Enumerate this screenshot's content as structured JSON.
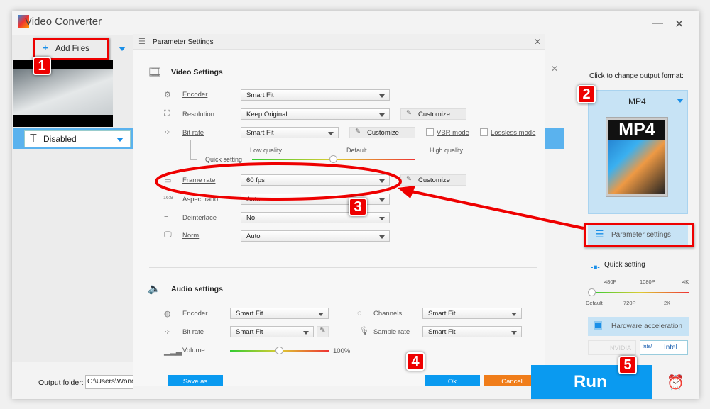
{
  "app": {
    "title": "Video Converter",
    "min": "—",
    "close": "✕"
  },
  "left": {
    "add_files": "Add Files",
    "subtitle": "Disabled"
  },
  "dialog": {
    "title": "Parameter Settings",
    "close": "✕",
    "video": {
      "heading": "Video Settings",
      "encoder": {
        "label": "Encoder",
        "value": "Smart Fit"
      },
      "resolution": {
        "label": "Resolution",
        "value": "Keep Original",
        "customize": "Customize"
      },
      "bitrate": {
        "label": "Bit rate",
        "value": "Smart Fit",
        "customize": "Customize",
        "vbr": "VBR mode",
        "lossless": "Lossless mode"
      },
      "quick": {
        "label": "Quick setting",
        "low": "Low quality",
        "default": "Default",
        "high": "High quality",
        "level": 0.5
      },
      "framerate": {
        "label": "Frame rate",
        "value": "60 fps",
        "customize": "Customize"
      },
      "aspect": {
        "label": "Aspect ratio",
        "value": "Auto"
      },
      "deinterlace": {
        "label": "Deinterlace",
        "value": "No"
      },
      "norm": {
        "label": "Norm",
        "value": "Auto"
      }
    },
    "audio": {
      "heading": "Audio settings",
      "encoder": {
        "label": "Encoder",
        "value": "Smart Fit"
      },
      "bitrate": {
        "label": "Bit rate",
        "value": "Smart Fit"
      },
      "volume": {
        "label": "Volume",
        "value": "100%",
        "level": 0.5
      },
      "channels": {
        "label": "Channels",
        "value": "Smart Fit"
      },
      "samplerate": {
        "label": "Sample rate",
        "value": "Smart Fit"
      }
    },
    "save_as": "Save as",
    "ok": "Ok",
    "cancel": "Cancel"
  },
  "right": {
    "format_hint": "Click to change output format:",
    "format": "MP4",
    "param_settings": "Parameter settings",
    "quick_setting": "Quick setting",
    "ticks_top": [
      "480P",
      "1080P",
      "4K"
    ],
    "ticks_bottom": [
      "Default",
      "720P",
      "2K"
    ],
    "hw": "Hardware acceleration",
    "nvidia": "NVIDIA",
    "intel": "Intel",
    "intel_logo": "intel"
  },
  "footer": {
    "output_label": "Output folder:",
    "output_path": "C:\\Users\\Wonde",
    "run": "Run"
  },
  "annotations": [
    "1",
    "2",
    "3",
    "4",
    "5"
  ],
  "colors": {
    "accent": "#0a9af0",
    "cancel": "#f07d1a",
    "annotation": "#e00000"
  }
}
